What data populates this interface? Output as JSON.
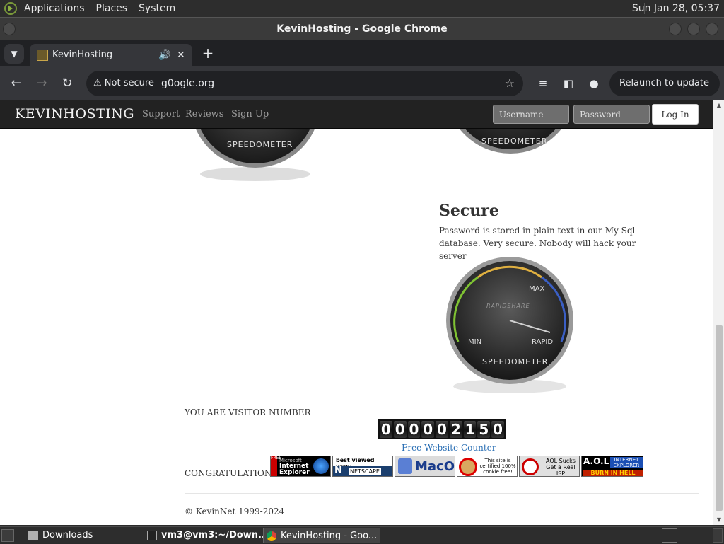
{
  "top_panel": {
    "menus": [
      "Applications",
      "Places",
      "System"
    ],
    "clock": "Sun Jan 28, 05:37"
  },
  "window": {
    "title": "KevinHosting - Google Chrome"
  },
  "browser": {
    "tab": {
      "title": "KevinHosting"
    },
    "omnibox": {
      "security": "Not secure",
      "url": "g0ogle.org"
    },
    "relaunch_label": "Relaunch to update"
  },
  "site": {
    "brand": "KEVINHOSTING",
    "nav": [
      "Support",
      "Reviews",
      "Sign Up"
    ],
    "login": {
      "username_placeholder": "Username",
      "password_placeholder": "Password",
      "button": "Log In"
    },
    "gauge_labels": {
      "min": "MIN",
      "rapid": "RAPID",
      "max": "MAX",
      "name": "SPEEDOMETER",
      "brand": "RAPIDSHARE"
    },
    "secure": {
      "heading": "Secure",
      "text": "Password is stored in plain text in our My Sql database. Very secure. Nobody will hack your server"
    },
    "visitor_label": "YOU ARE VISITOR NUMBER",
    "counter_digits": [
      "0",
      "0",
      "0",
      "0",
      "0",
      "2",
      "1",
      "5",
      "0"
    ],
    "counter_link": "Free Website Counter",
    "congrats": "CONGRATULATION",
    "badges": {
      "ie_free": "FREE",
      "ie_ms": "Microsoft",
      "ie_name": "Internet",
      "ie_name2": "Explorer",
      "netscape_top": "best viewed with:",
      "netscape_name": "NETSCAPE",
      "macos": "MacOS",
      "cookie": "This site is certified 100% cookie free!",
      "aol": "AOL Sucks Get a Real ISP",
      "aol_ie_top": "A.O.L",
      "aol_ie_right": "INTERNET EXPLORER",
      "aol_ie_bottom": "BURN IN HELL"
    },
    "footer": "© KevinNet 1999-2024"
  },
  "taskbar": {
    "items": [
      "Downloads",
      "vm3@vm3:~/Down...",
      "KevinHosting - Goo..."
    ]
  },
  "colors": {
    "site_nav_bg": "#222222",
    "link": "#2a6fb4",
    "chrome_dark": "#202124",
    "chrome_toolbar": "#35363a"
  }
}
